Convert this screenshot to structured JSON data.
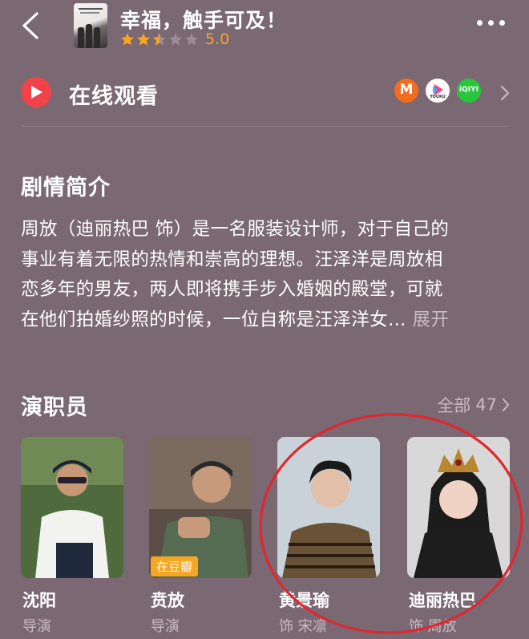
{
  "header": {
    "title": "幸福，触手可及！",
    "score": "5.0",
    "stars_filled": 2.5,
    "stars_total": 5,
    "icons": {
      "back": "chevron-left-icon",
      "more": "more-dots-icon"
    }
  },
  "watch": {
    "label": "在线观看",
    "platforms": [
      {
        "name": "mgtv",
        "glyph": "M",
        "color": "#f26d1f"
      },
      {
        "name": "youku",
        "glyph": "YOUKU",
        "color": "#ffffff"
      },
      {
        "name": "iqiyi",
        "glyph": "iQIYI",
        "color": "#27c63c"
      }
    ]
  },
  "synopsis": {
    "title": "剧情简介",
    "lines": [
      "周放（迪丽热巴 饰）是一名服装设计师，对于自己的",
      "事业有着无限的热情和崇高的理想。汪泽洋是周放相",
      "恋多年的男友，两人即将携手步入婚姻的殿堂，可就",
      "在他们拍婚纱照的时候，一位自称是汪泽洋女…"
    ],
    "expand": "展开"
  },
  "cast": {
    "title": "演职员",
    "all_label": "全部",
    "all_count": "47",
    "members": [
      {
        "name": "沈阳",
        "role": "导演",
        "badge": ""
      },
      {
        "name": "贲放",
        "role": "导演",
        "badge": "在豆瓣"
      },
      {
        "name": "黄景瑜",
        "role": "饰 宋凛",
        "badge": ""
      },
      {
        "name": "迪丽热巴",
        "role": "饰 周放",
        "badge": ""
      }
    ]
  },
  "colors": {
    "background": "#7a6872",
    "accent": "#f6a623",
    "play": "#f2434a",
    "muted": "#c9bcc3",
    "annotation": "#e0272f"
  }
}
